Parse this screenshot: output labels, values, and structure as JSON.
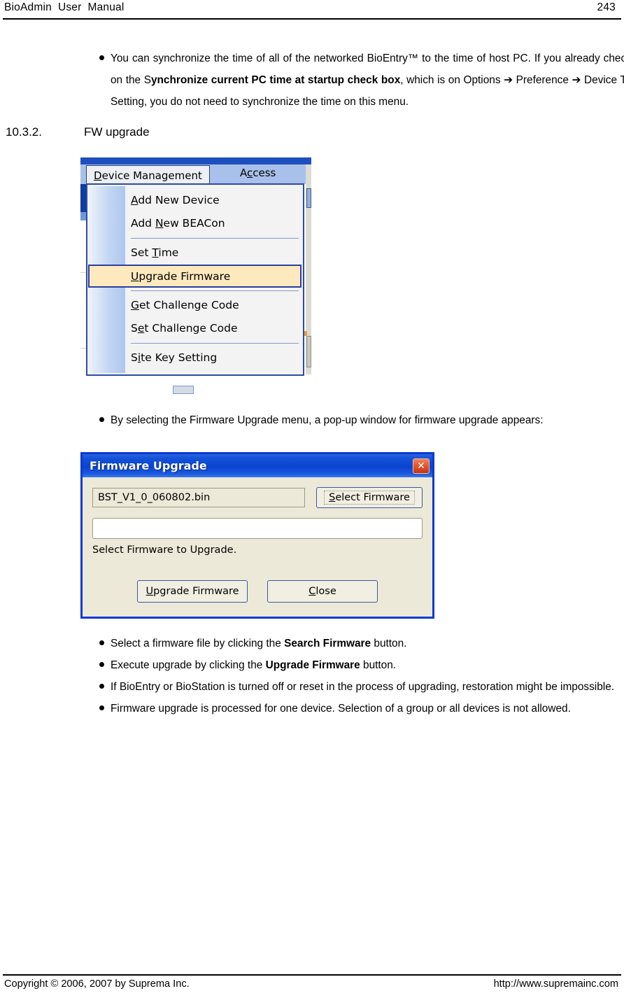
{
  "header": {
    "title": "BioAdmin  User  Manual",
    "page_number": "243"
  },
  "footer": {
    "copyright": "Copyright © 2006, 2007 by Suprema Inc.",
    "website": "http://www.supremainc.com"
  },
  "section": {
    "number": "10.3.2.",
    "title": "FW upgrade"
  },
  "bullets": {
    "b1": {
      "part1": "You can synchronize the time of all of the networked BioEntry™ to the time of host PC. If you already checked on the S",
      "bold1": "ynchronize current PC time at startup check box",
      "part2": ", which is on Options ",
      "arrow1": "➔",
      "part3": " Preference ",
      "arrow2": "➔",
      "part4": " Device Time Setting, you do not need to synchronize the time on this menu."
    },
    "b2": {
      "text": "By selecting the  Firmware Upgrade menu, a pop-up window for firmware upgrade appears:"
    },
    "b3": {
      "part1": "Select a firmware file by clicking the ",
      "bold1": "Search Firmware",
      "part2": " button."
    },
    "b4": {
      "part1": "Execute upgrade by clicking the ",
      "bold1": "Upgrade Firmware",
      "part2": " button."
    },
    "b5": {
      "text": "If BioEntry or BioStation is turned off or reset in the process of upgrading, restoration might be impossible."
    },
    "b6": {
      "text": "Firmware upgrade is processed for one device. Selection of a group or all devices is not allowed."
    }
  },
  "menu_screenshot": {
    "menubar": {
      "active_menu_pre": "D",
      "active_menu_acc": "D",
      "active_menu_label_rest": "evice Management",
      "other_menu_label_a": "A",
      "other_menu_acc": "c",
      "other_menu_label_rest": "cess"
    },
    "items": [
      {
        "pre": "",
        "acc": "A",
        "post": "dd New Device",
        "selected": false,
        "separator_after": false
      },
      {
        "pre": "Add ",
        "acc": "N",
        "post": "ew BEACon",
        "selected": false,
        "separator_after": true
      },
      {
        "pre": "Set ",
        "acc": "T",
        "post": "ime",
        "selected": false,
        "separator_after": false
      },
      {
        "pre": "",
        "acc": "U",
        "post": "pgrade Firmware",
        "selected": true,
        "separator_after": true
      },
      {
        "pre": "",
        "acc": "G",
        "post": "et Challenge Code",
        "selected": false,
        "separator_after": false
      },
      {
        "pre": "S",
        "acc": "e",
        "post": "t Challenge Code",
        "selected": false,
        "separator_after": true
      },
      {
        "pre": "S",
        "acc": "i",
        "post": "te Key Setting",
        "selected": false,
        "separator_after": false
      }
    ],
    "colors": {
      "highlight_bg": "#fde9bd",
      "highlight_border": "#2a3f9e",
      "menubar_bg": "#a8c0ea",
      "dropdown_border": "#2a4ba8"
    }
  },
  "fw_dialog": {
    "title": "Firmware Upgrade",
    "close_glyph": "✕",
    "file_value": "BST_V1_0_060802.bin",
    "select_button": {
      "acc": "S",
      "rest": "elect Firmware"
    },
    "progress_value": "",
    "status_text": "Select Firmware to Upgrade.",
    "upgrade_button": {
      "acc": "U",
      "rest": "pgrade Firmware"
    },
    "close_button": {
      "acc": "C",
      "rest": "lose"
    },
    "colors": {
      "titlebar": "#0a44d0",
      "face": "#ece9d8",
      "close_button": "#e2562e",
      "border": "#0a3ad4"
    }
  }
}
